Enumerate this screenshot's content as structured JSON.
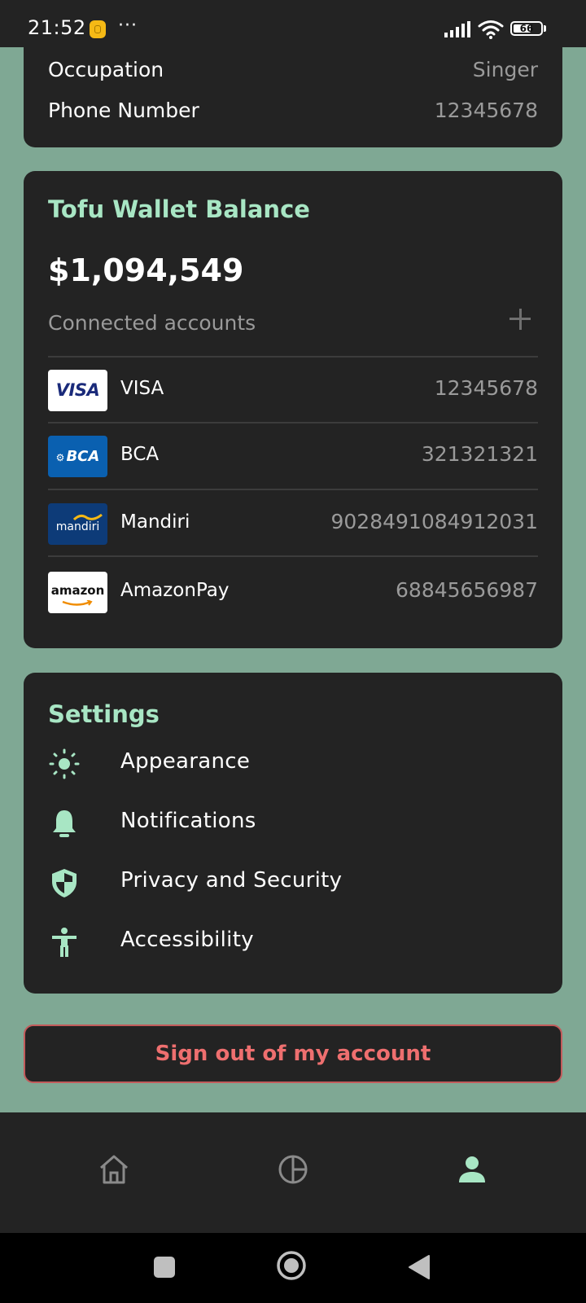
{
  "status_bar": {
    "time": "21:52",
    "more_indicator": "···",
    "battery": "66",
    "battery_level": 0.66,
    "icons": [
      "app-notification-icon",
      "signal-icon",
      "wifi-icon",
      "battery-icon"
    ]
  },
  "profile": {
    "rows": [
      {
        "label": "Occupation",
        "value": "Singer"
      },
      {
        "label": "Phone Number",
        "value": "12345678"
      }
    ]
  },
  "wallet": {
    "title": "Tofu Wallet Balance",
    "balance": "$1,094,549",
    "connected_label": "Connected accounts",
    "add_icon": "plus-icon",
    "accounts": [
      {
        "logo_text": "VISA",
        "name": "VISA",
        "number": "12345678"
      },
      {
        "logo_text": "BCA",
        "name": "BCA",
        "number": "321321321"
      },
      {
        "logo_text": "mandiri",
        "name": "Mandiri",
        "number": "9028491084912031"
      },
      {
        "logo_text": "amazon",
        "name": "AmazonPay",
        "number": "68845656987"
      }
    ]
  },
  "settings": {
    "title": "Settings",
    "items": [
      {
        "label": "Appearance",
        "icon": "sun-icon"
      },
      {
        "label": "Notifications",
        "icon": "bell-icon"
      },
      {
        "label": "Privacy and Security",
        "icon": "shield-icon"
      },
      {
        "label": "Accessibility",
        "icon": "accessibility-icon"
      }
    ]
  },
  "signout": {
    "label": "Sign out of my account"
  },
  "bottom_nav": {
    "items": [
      {
        "icon": "home-icon",
        "active": false
      },
      {
        "icon": "pie-chart-icon",
        "active": false
      },
      {
        "icon": "profile-icon",
        "active": true
      }
    ]
  },
  "colors": {
    "background": "#7fa894",
    "card": "#232323",
    "accent": "#a8e6c4",
    "muted_text": "#9a9a9a",
    "danger": "#ee6f6f",
    "inactive_icon": "#8a8a8a"
  }
}
